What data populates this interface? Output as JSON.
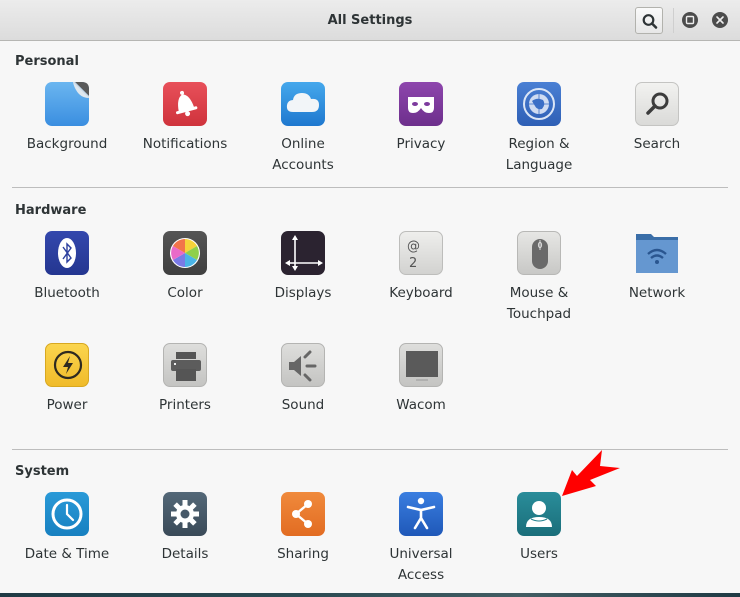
{
  "window": {
    "title": "All Settings",
    "controls": {
      "search": "search-icon",
      "maximize": "maximize-icon",
      "close": "close-icon"
    }
  },
  "sections": [
    {
      "title": "Personal",
      "items": [
        {
          "label": "Background",
          "icon": "background-icon",
          "color": "#4a9fe6"
        },
        {
          "label": "Notifications",
          "icon": "bell-icon",
          "color": "#dd3c44"
        },
        {
          "label": "Online\nAccounts",
          "icon": "cloud-icon",
          "color": "#2a86d8"
        },
        {
          "label": "Privacy",
          "icon": "mask-icon",
          "color": "#7d3a9e"
        },
        {
          "label": "Region &\nLanguage",
          "icon": "globe-icon",
          "color": "#3a6fc6"
        },
        {
          "label": "Search",
          "icon": "magnifier-icon",
          "color": "#e4e4e2"
        }
      ]
    },
    {
      "title": "Hardware",
      "items": [
        {
          "label": "Bluetooth",
          "icon": "bluetooth-icon",
          "color": "#2c3f9e"
        },
        {
          "label": "Color",
          "icon": "color-wheel-icon",
          "color": "#4a4a4a"
        },
        {
          "label": "Displays",
          "icon": "display-arrows-icon",
          "color": "#2b2330"
        },
        {
          "label": "Keyboard",
          "icon": "keyboard-key-icon",
          "color": "#dcdcda"
        },
        {
          "label": "Mouse &\nTouchpad",
          "icon": "mouse-icon",
          "color": "#d4d4d2"
        },
        {
          "label": "Network",
          "icon": "network-folder-icon",
          "color": "#5b8fc9"
        },
        {
          "label": "Power",
          "icon": "power-icon",
          "color": "#f6c83a"
        },
        {
          "label": "Printers",
          "icon": "printer-icon",
          "color": "#cfcfcd"
        },
        {
          "label": "Sound",
          "icon": "speaker-icon",
          "color": "#cfcfcd"
        },
        {
          "label": "Wacom",
          "icon": "tablet-icon",
          "color": "#d2d2d0"
        }
      ]
    },
    {
      "title": "System",
      "items": [
        {
          "label": "Date & Time",
          "icon": "clock-icon",
          "color": "#1f8ccc"
        },
        {
          "label": "Details",
          "icon": "gear-icon",
          "color": "#465868"
        },
        {
          "label": "Sharing",
          "icon": "share-icon",
          "color": "#ec7b2f"
        },
        {
          "label": "Universal\nAccess",
          "icon": "accessibility-icon",
          "color": "#2467c9"
        },
        {
          "label": "Users",
          "icon": "user-icon",
          "color": "#1f7f8c"
        }
      ]
    }
  ],
  "annotation": {
    "type": "red-arrow",
    "target": "Users",
    "color": "#ff0000"
  }
}
